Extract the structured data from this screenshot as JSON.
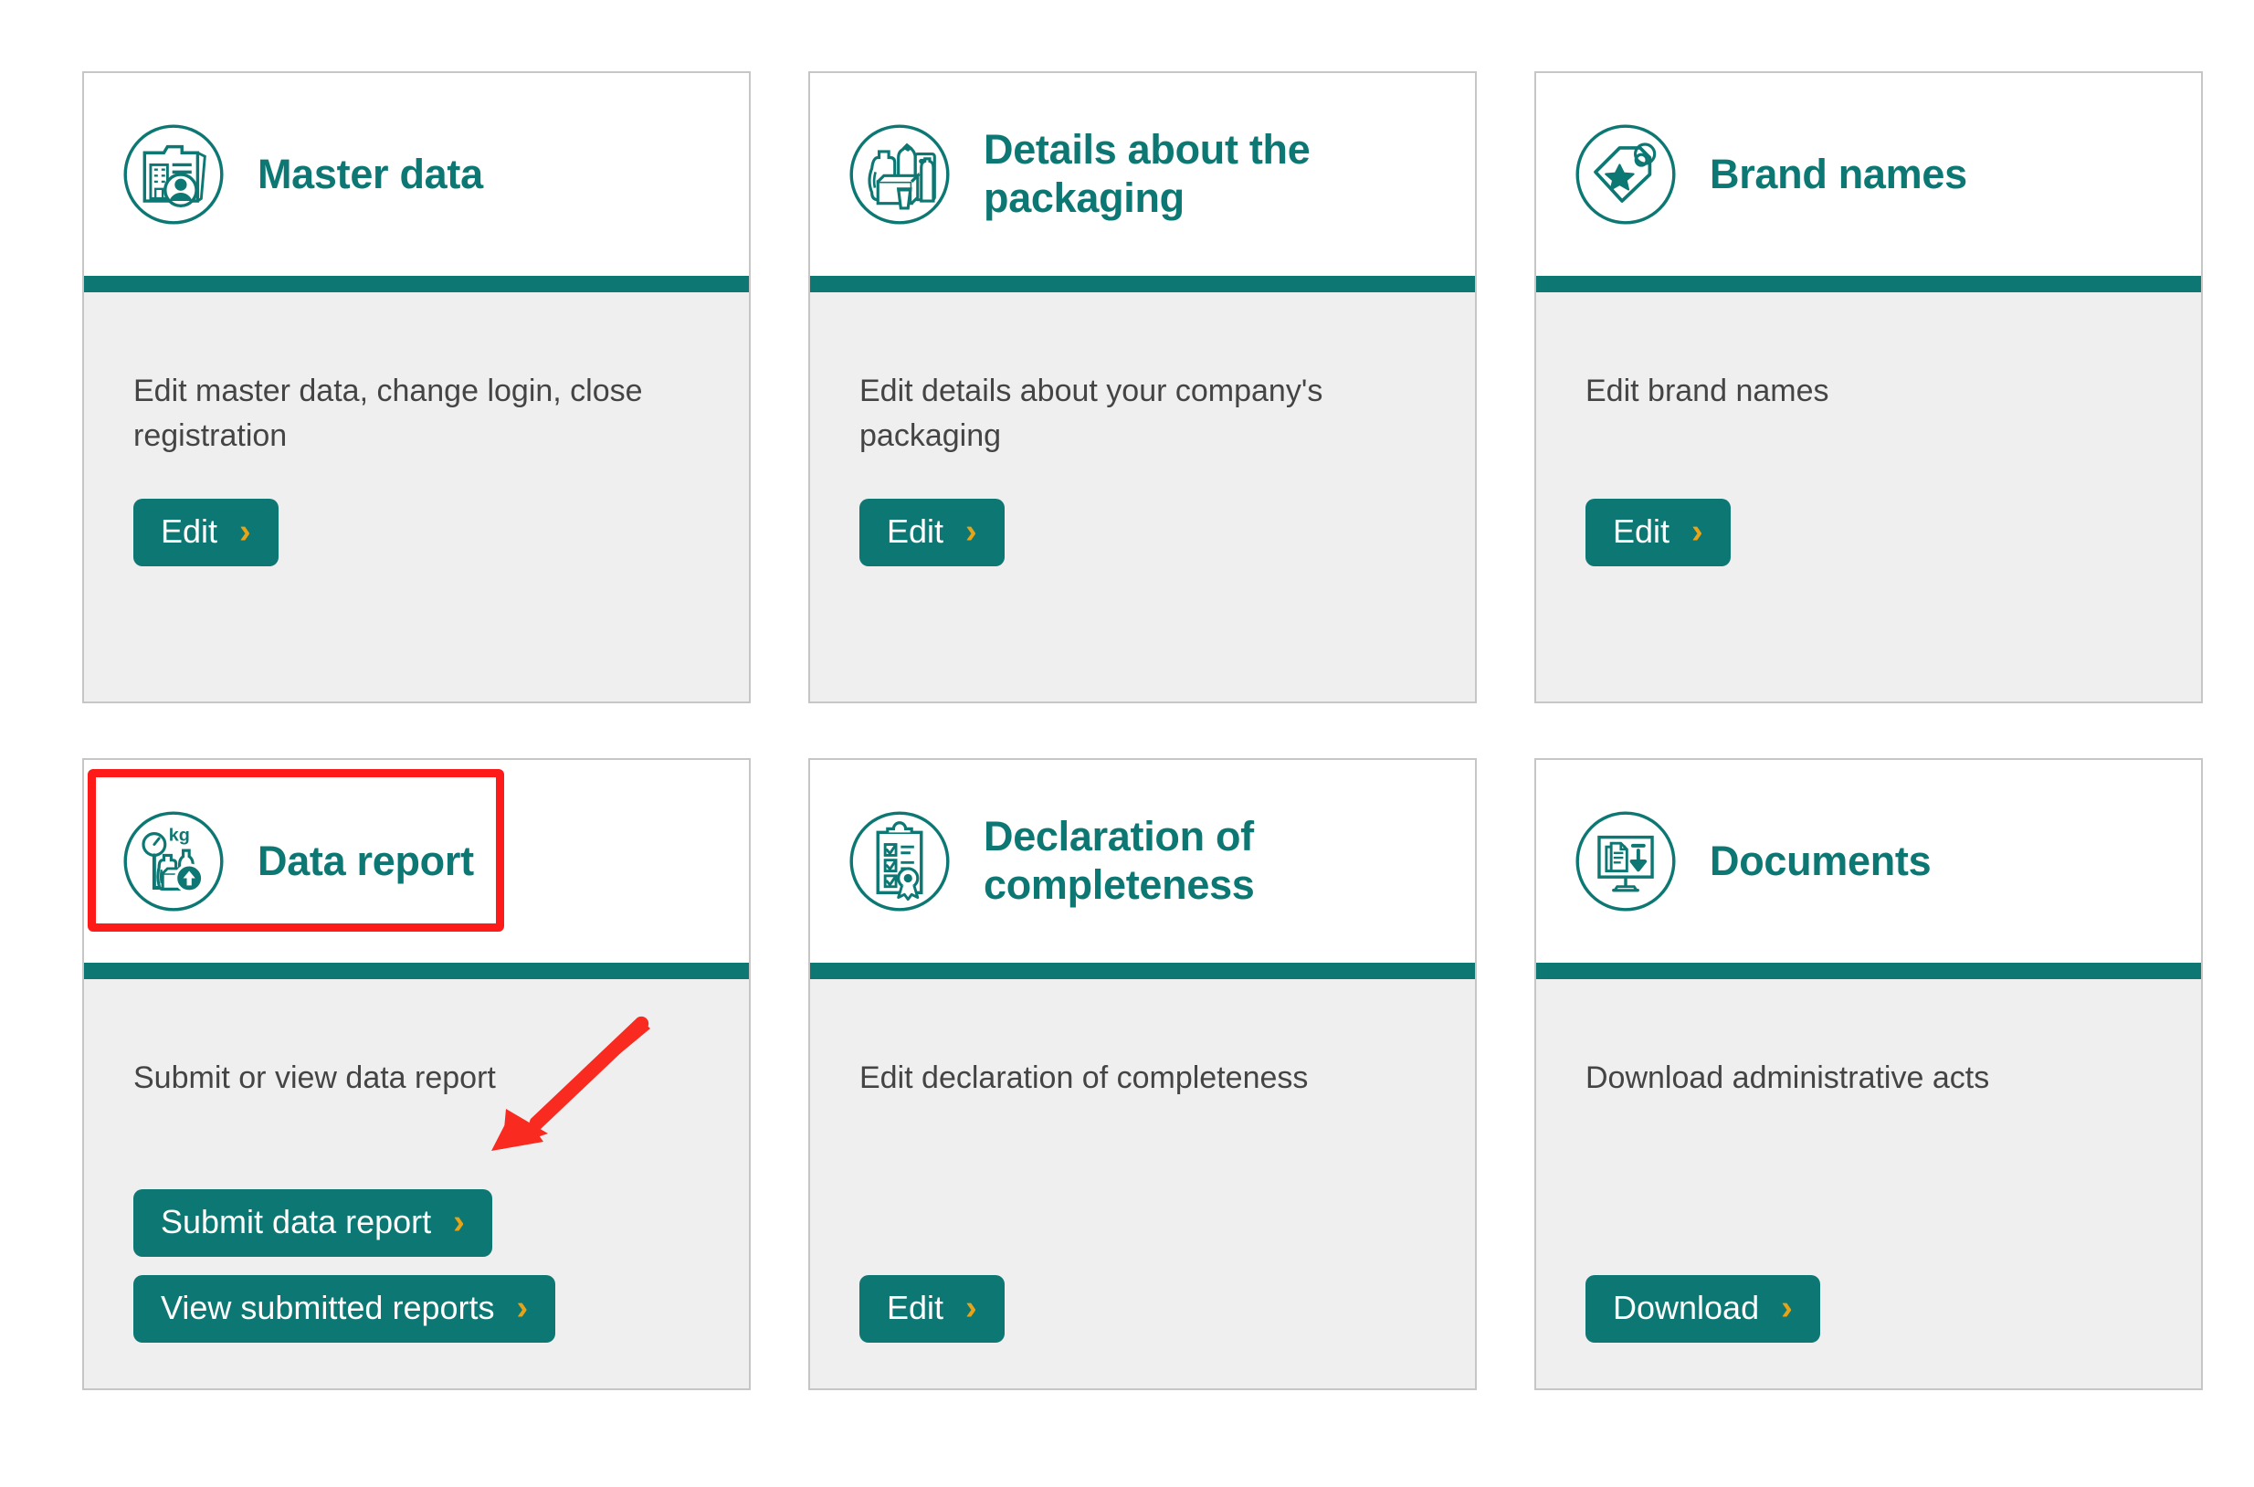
{
  "page": {
    "background_color": "#ffffff",
    "accent_color": "#0d7873",
    "body_background": "#efefef",
    "border_color": "#c6c6c6",
    "chevron_color": "#e8a317",
    "annotation_color": "#ff1a1a",
    "text_color": "#444444"
  },
  "cards": [
    {
      "id": "master-data",
      "title": "Master data",
      "icon": "folder-building-person-icon",
      "description": "Edit master data, change login, close registration",
      "buttons": [
        {
          "label": "Edit",
          "chevron": "›",
          "name": "edit-master-data-button"
        }
      ]
    },
    {
      "id": "details-about-packaging",
      "title": "Details about the packaging",
      "icon": "packaging-items-icon",
      "description": "Edit details about your company's packaging",
      "buttons": [
        {
          "label": "Edit",
          "chevron": "›",
          "name": "edit-packaging-details-button"
        }
      ]
    },
    {
      "id": "brand-names",
      "title": "Brand names",
      "icon": "price-tag-star-icon",
      "description": "Edit brand names",
      "buttons": [
        {
          "label": "Edit",
          "chevron": "›",
          "name": "edit-brand-names-button"
        }
      ]
    },
    {
      "id": "data-report",
      "title": "Data report",
      "icon": "scale-kg-upload-icon",
      "description": "Submit or view data report",
      "highlighted": true,
      "buttons": [
        {
          "label": "Submit data report",
          "chevron": "›",
          "name": "submit-data-report-button"
        },
        {
          "label": "View submitted reports",
          "chevron": "›",
          "name": "view-submitted-reports-button"
        }
      ]
    },
    {
      "id": "declaration-of-completeness",
      "title": "Declaration of completeness",
      "icon": "clipboard-checklist-seal-icon",
      "description": "Edit declaration of completeness",
      "buttons": [
        {
          "label": "Edit",
          "chevron": "›",
          "name": "edit-declaration-button"
        }
      ]
    },
    {
      "id": "documents",
      "title": "Documents",
      "icon": "monitor-documents-download-icon",
      "description": "Download administrative acts",
      "buttons": [
        {
          "label": "Download",
          "chevron": "›",
          "name": "download-documents-button"
        }
      ]
    }
  ],
  "annotations": {
    "highlight_box": {
      "name": "data-report-header-highlight",
      "target": "data-report card header",
      "color": "#ff1a1a"
    },
    "arrow": {
      "name": "submit-data-report-arrow",
      "target": "Submit data report button",
      "color": "#ff1a1a"
    }
  }
}
